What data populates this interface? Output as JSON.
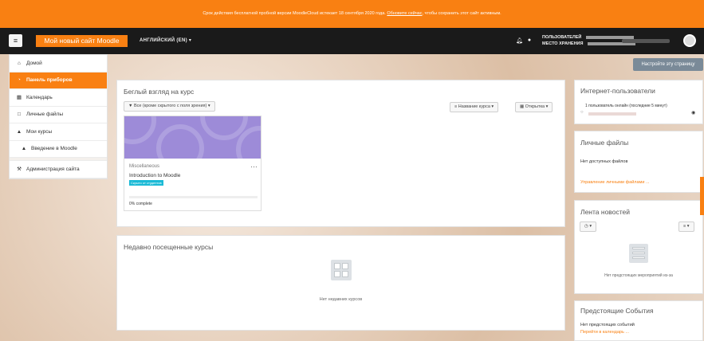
{
  "banner": {
    "text_before": "Срок действия бесплатной пробной версии MoodleCloud истекает 18 сентября 2020 года.",
    "link_text": "Обновите сейчас",
    "text_after": ", чтобы сохранить этот сайт активным."
  },
  "navbar": {
    "menu_icon": "hamburger-icon",
    "site_name": "Мой новый сайт Moodle",
    "language": "АНГЛИЙСКИЙ (EN) ▾",
    "user_line1": "ПОЛЬЗОВАТЕЛЕЙ",
    "user_line2": "МЕСТО ХРАНЕНИЯ"
  },
  "sidebar": {
    "items": [
      {
        "label": "Домой",
        "icon": "home-icon"
      },
      {
        "label": "Панель приборов",
        "icon": "dashboard-icon"
      },
      {
        "label": "Календарь",
        "icon": "calendar-icon"
      },
      {
        "label": "Личные файлы",
        "icon": "file-icon"
      },
      {
        "label": "Мои курсы",
        "icon": "courses-icon"
      },
      {
        "label": "Введение в Moodle",
        "icon": "course-icon"
      },
      {
        "label": "Администрация сайта",
        "icon": "wrench-icon"
      }
    ]
  },
  "customize_button": "Настройте эту страницу",
  "overview": {
    "title": "Беглый взгляд на курс",
    "filter": "▼ Все (кроме скрытого с поля зрения) ▾",
    "sort": "Название курса ▾",
    "view": "Открытка ▾",
    "course": {
      "category": "Miscellaneous",
      "name": "Introduction to Moodle",
      "badge": "Скрыто от студентов",
      "progress_text": "0% complete",
      "progress": 0
    }
  },
  "recent": {
    "title": "Недавно посещенные курсы",
    "empty": "Нет недавних курсов"
  },
  "online": {
    "title": "Интернет-пользователи",
    "text": "1 пользователь онлайн (последние 5 минут)"
  },
  "files": {
    "title": "Личные файлы",
    "empty": "Нет доступных файлов",
    "link": "Управление личными файлами ..."
  },
  "timeline": {
    "title": "Лента новостей",
    "empty": "Нет предстоящих мероприятий из-за"
  },
  "upcoming": {
    "title": "Предстоящие События",
    "empty": "Нет предстоящих событий",
    "link": "Перейти в календарь ..."
  },
  "colors": {
    "brand": "#f98012",
    "navbar": "#1a1a1a",
    "badge": "#1cbad6",
    "course_image": "#9d8bd8"
  }
}
